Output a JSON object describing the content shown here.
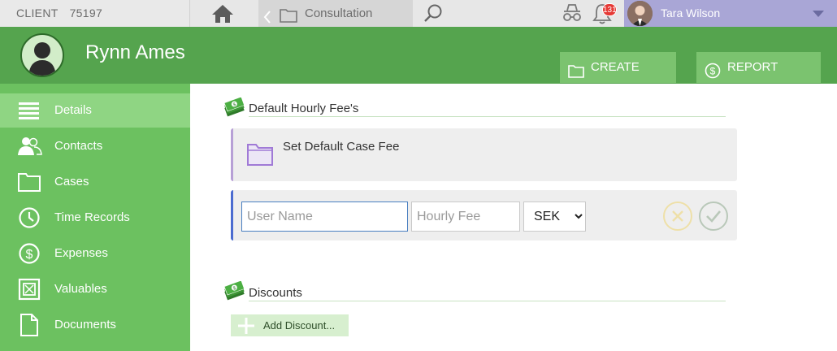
{
  "topbar": {
    "client_label": "CLIENT",
    "client_number": "75197",
    "breadcrumb": "Consultation",
    "notifications_count": "131",
    "user_name": "Tara Wilson"
  },
  "header": {
    "client_name": "Rynn Ames",
    "create_case_label": "CREATE CASE",
    "report_asset_label": "REPORT ASSET"
  },
  "sidebar": {
    "items": [
      {
        "label": "Details",
        "icon": "list-icon"
      },
      {
        "label": "Contacts",
        "icon": "contacts-icon"
      },
      {
        "label": "Cases",
        "icon": "folder-icon"
      },
      {
        "label": "Time Records",
        "icon": "clock-icon"
      },
      {
        "label": "Expenses",
        "icon": "dollar-icon"
      },
      {
        "label": "Valuables",
        "icon": "safe-icon"
      },
      {
        "label": "Documents",
        "icon": "document-icon"
      }
    ]
  },
  "main": {
    "fee_section_title": "Default Hourly Fee's",
    "set_default_fee_label": "Set Default Case Fee",
    "user_name_placeholder": "User Name",
    "hourly_fee_placeholder": "Hourly Fee",
    "currency_selected": "SEK",
    "discounts_title": "Discounts",
    "add_discount_label": "Add Discount..."
  },
  "colors": {
    "header_green": "#55a44e",
    "sidebar_green": "#6cc160",
    "active_item": "#8fd583",
    "user_box": "#a9a6d6",
    "badge_red": "#e53935"
  }
}
